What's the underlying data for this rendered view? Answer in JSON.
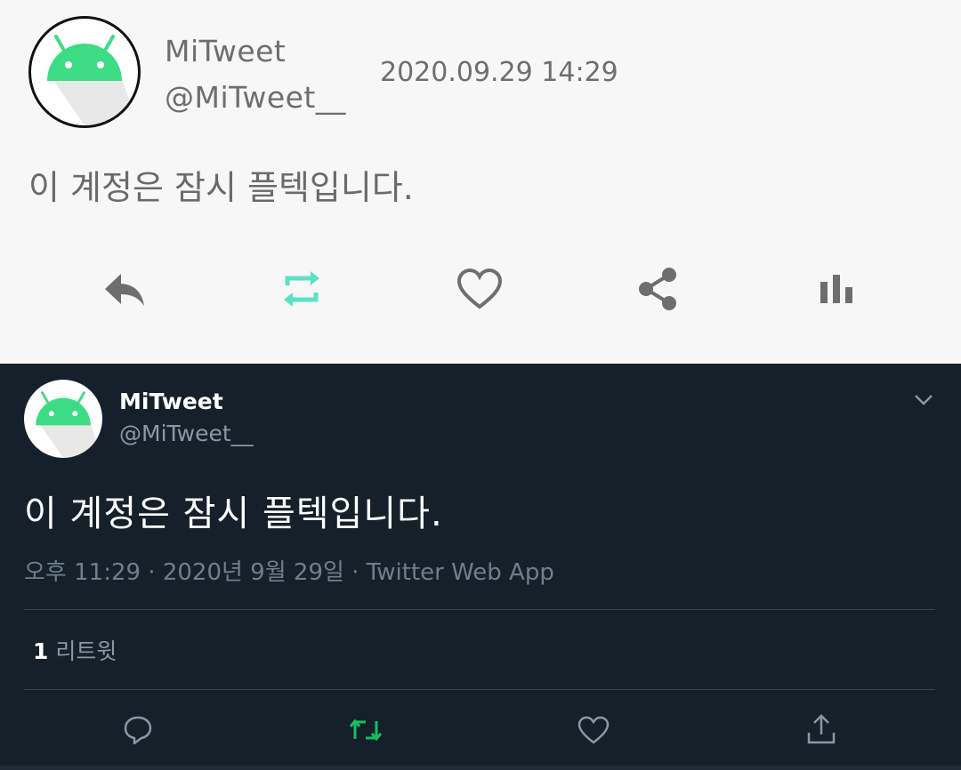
{
  "light_card": {
    "display_name": "MiTweet",
    "handle": "@MiTweet__",
    "timestamp": "2020.09.29 14:29",
    "text": "이 계정은 잠시 플텍입니다.",
    "actions": [
      {
        "icon": "reply-icon",
        "color": "#6e6e6e"
      },
      {
        "icon": "retweet-icon",
        "color": "#5ce1c5"
      },
      {
        "icon": "heart-icon",
        "color": "#6e6e6e"
      },
      {
        "icon": "share-icon",
        "color": "#6e6e6e"
      },
      {
        "icon": "stats-icon",
        "color": "#6e6e6e"
      }
    ]
  },
  "dark_card": {
    "display_name": "MiTweet",
    "handle": "@MiTweet__",
    "text": "이 계정은 잠시 플텍입니다.",
    "meta": "오후 11:29 · 2020년 9월 29일 · Twitter Web App",
    "retweet_count": "1",
    "retweet_label": "리트윗",
    "actions": [
      {
        "icon": "reply-icon",
        "color": "#8899a6"
      },
      {
        "icon": "retweet-icon",
        "color": "#17bf63"
      },
      {
        "icon": "like-icon",
        "color": "#8899a6"
      },
      {
        "icon": "share-icon",
        "color": "#8899a6"
      }
    ]
  },
  "colors": {
    "android_green": "#3ddc84",
    "dark_background": "#15202b",
    "light_background": "#f7f7f7"
  }
}
